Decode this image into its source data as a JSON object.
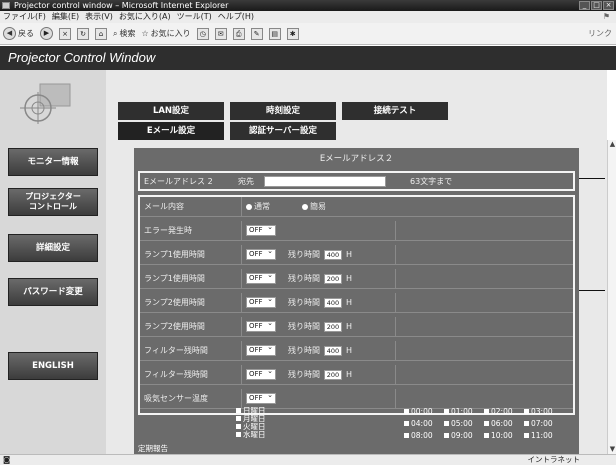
{
  "window": {
    "title": "Projector control window – Microsoft Internet Explorer"
  },
  "menu": [
    "ファイル(F)",
    "編集(E)",
    "表示(V)",
    "お気に入り(A)",
    "ツール(T)",
    "ヘルプ(H)"
  ],
  "toolbar": {
    "back": "戻る",
    "search": "検索",
    "favorites": "お気に入り",
    "links": "リンク"
  },
  "app": {
    "title": "Projector Control Window"
  },
  "nav": {
    "monitor": "モニター情報",
    "projector_line1": "プロジェクター",
    "projector_line2": "コントロール",
    "detail": "詳細設定",
    "password": "パスワード変更",
    "english": "ENGLISH"
  },
  "tabs": {
    "lan": "LAN設定",
    "time": "時刻設定",
    "conn_test": "接続テスト",
    "email": "Eメール設定",
    "auth": "認証サーバー設定"
  },
  "section": {
    "header": "Eメールアドレス２",
    "address_label": "Eメールアドレス 2",
    "address_to": "宛先",
    "address_value": "",
    "address_hint": "63文字まで"
  },
  "mail": {
    "content_label": "メール内容",
    "opt_normal": "通常",
    "opt_simple": "簡易"
  },
  "rows": [
    {
      "label": "エラー発生時",
      "select": "OFF",
      "remain_label": "",
      "remain": "",
      "unit": ""
    },
    {
      "label": "ランプ1使用時間",
      "select": "OFF",
      "remain_label": "残り時間",
      "remain": "400",
      "unit": "H"
    },
    {
      "label": "ランプ1使用時間",
      "select": "OFF",
      "remain_label": "残り時間",
      "remain": "200",
      "unit": "H"
    },
    {
      "label": "ランプ2使用時間",
      "select": "OFF",
      "remain_label": "残り時間",
      "remain": "400",
      "unit": "H"
    },
    {
      "label": "ランプ2使用時間",
      "select": "OFF",
      "remain_label": "残り時間",
      "remain": "200",
      "unit": "H"
    },
    {
      "label": "フィルター残時間",
      "select": "OFF",
      "remain_label": "残り時間",
      "remain": "400",
      "unit": "H"
    },
    {
      "label": "フィルター残時間",
      "select": "OFF",
      "remain_label": "残り時間",
      "remain": "200",
      "unit": "H"
    },
    {
      "label": "吸気センサー温度",
      "select": "OFF",
      "remain_label": "",
      "remain": "",
      "unit": ""
    }
  ],
  "schedule": {
    "label": "定期報告",
    "days": [
      "日曜日",
      "月曜日",
      "火曜日",
      "水曜日"
    ],
    "times": [
      "00:00",
      "01:00",
      "02:00",
      "03:00",
      "04:00",
      "05:00",
      "06:00",
      "07:00",
      "08:00",
      "09:00",
      "10:00",
      "11:00"
    ]
  },
  "status": {
    "zone": "イントラネット"
  },
  "colors": {
    "app_bar": "#2e2e2e",
    "form_bg": "#6b6b6b",
    "nav_btn": "#4a4a4a"
  }
}
